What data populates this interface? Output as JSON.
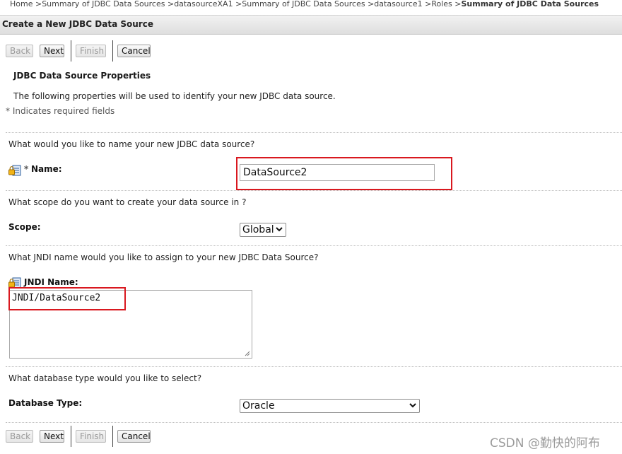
{
  "breadcrumb": {
    "items": [
      "Home",
      "Summary of JDBC Data Sources",
      "datasourceXA1",
      "Summary of JDBC Data Sources",
      "datasource1",
      "Roles"
    ],
    "current": "Summary of JDBC Data Sources",
    "separator": ">"
  },
  "page": {
    "title": "Create a New JDBC Data Source"
  },
  "wizard": {
    "back_label": "Back",
    "next_label": "Next",
    "finish_label": "Finish",
    "cancel_label": "Cancel"
  },
  "section": {
    "title": "JDBC Data Source Properties",
    "description": "The following properties will be used to identify your new JDBC data source.",
    "required_note": "* Indicates required fields"
  },
  "fields": {
    "name": {
      "question": "What would you like to name your new JDBC data source?",
      "required_mark": "*",
      "label": "Name:",
      "value": "DataSource2"
    },
    "scope": {
      "question": "What scope do you want to create your data source in ?",
      "label": "Scope:",
      "value": "Global"
    },
    "jndi": {
      "question": "What JNDI name would you like to assign to your new JDBC Data Source?",
      "label": "JNDI Name:",
      "value": "JNDI/DataSource2"
    },
    "db_type": {
      "question": "What database type would you like to select?",
      "label": "Database Type:",
      "value": "Oracle"
    }
  },
  "watermark": "CSDN @勤快的阿布",
  "colors": {
    "highlight": "#d9181f",
    "header_bar": "#e6e6e6"
  },
  "icons": {
    "field_help": "lock-note-icon",
    "dropdown": "chevron-down-icon"
  }
}
